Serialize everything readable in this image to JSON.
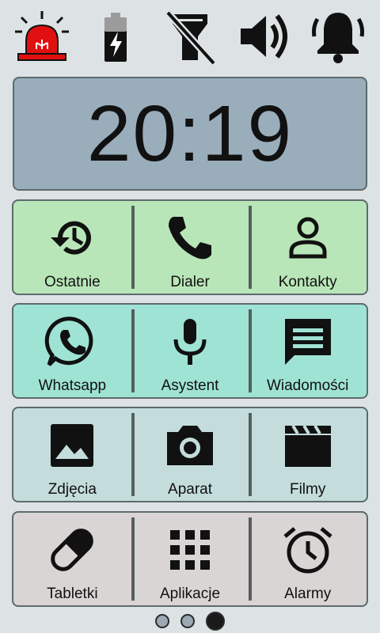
{
  "status_icons": [
    "alarm-siren-icon",
    "battery-charging-icon",
    "flashlight-off-icon",
    "volume-icon",
    "bell-icon"
  ],
  "colors": {
    "siren_red": "#e01010",
    "clock_bg": "#9aadbb",
    "row1_bg": "#b9e6b8",
    "row2_bg": "#9fe3d4",
    "row3_bg": "#c4dcdc",
    "row4_bg": "#d9d5d4"
  },
  "clock": {
    "time": "20:19"
  },
  "rows": [
    {
      "tiles": [
        {
          "label": "Ostatnie",
          "icon": "history-icon"
        },
        {
          "label": "Dialer",
          "icon": "phone-icon"
        },
        {
          "label": "Kontakty",
          "icon": "person-icon"
        }
      ]
    },
    {
      "tiles": [
        {
          "label": "Whatsapp",
          "icon": "whatsapp-icon"
        },
        {
          "label": "Asystent",
          "icon": "microphone-icon"
        },
        {
          "label": "Wiadomości",
          "icon": "message-icon"
        }
      ]
    },
    {
      "tiles": [
        {
          "label": "Zdjęcia",
          "icon": "image-icon"
        },
        {
          "label": "Aparat",
          "icon": "camera-icon"
        },
        {
          "label": "Filmy",
          "icon": "clapperboard-icon"
        }
      ]
    },
    {
      "tiles": [
        {
          "label": "Tabletki",
          "icon": "pill-icon"
        },
        {
          "label": "Aplikacje",
          "icon": "apps-grid-icon"
        },
        {
          "label": "Alarmy",
          "icon": "alarm-clock-icon"
        }
      ]
    }
  ],
  "pager": {
    "pages": 3,
    "current": 3
  }
}
